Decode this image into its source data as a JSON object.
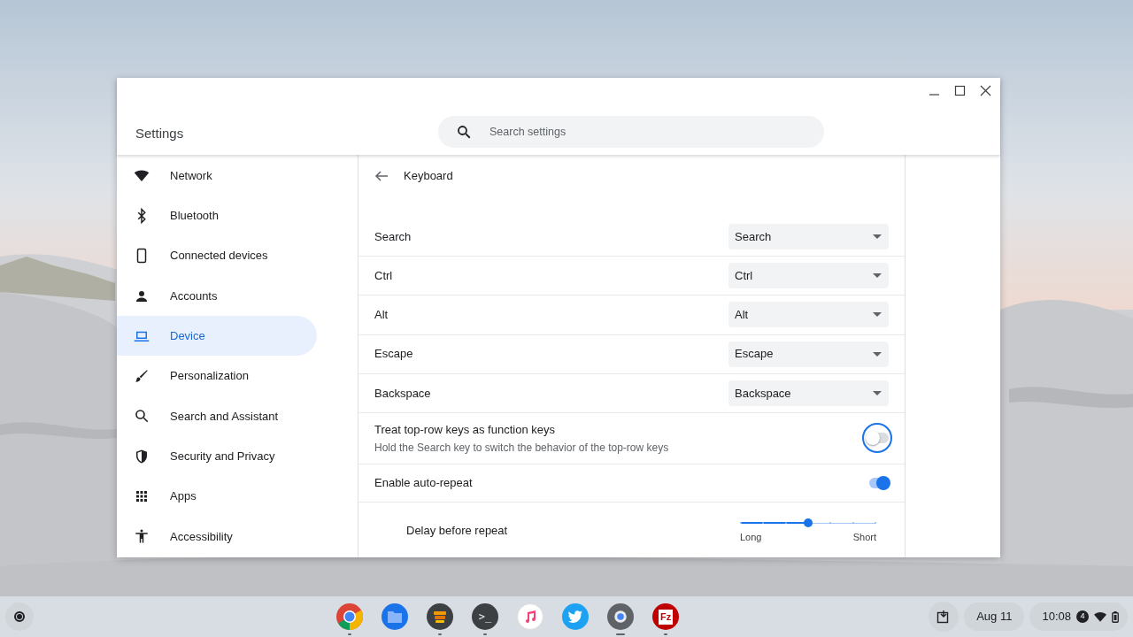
{
  "window": {
    "title": "Settings"
  },
  "search": {
    "placeholder": "Search settings"
  },
  "sidebar": {
    "items": [
      {
        "label": "Network",
        "kind": "wifi",
        "selected": false
      },
      {
        "label": "Bluetooth",
        "kind": "bluetooth",
        "selected": false
      },
      {
        "label": "Connected devices",
        "kind": "phone",
        "selected": false
      },
      {
        "label": "Accounts",
        "kind": "person",
        "selected": false
      },
      {
        "label": "Device",
        "kind": "laptop",
        "selected": true
      },
      {
        "label": "Personalization",
        "kind": "brush",
        "selected": false
      },
      {
        "label": "Search and Assistant",
        "kind": "search",
        "selected": false
      },
      {
        "label": "Security and Privacy",
        "kind": "shield",
        "selected": false
      },
      {
        "label": "Apps",
        "kind": "grid",
        "selected": false
      },
      {
        "label": "Accessibility",
        "kind": "accessibility",
        "selected": false
      }
    ]
  },
  "page": {
    "title": "Keyboard",
    "rows": [
      {
        "kind": "select",
        "label": "Search",
        "value": "Search"
      },
      {
        "kind": "select",
        "label": "Ctrl",
        "value": "Ctrl"
      },
      {
        "kind": "select",
        "label": "Alt",
        "value": "Alt"
      },
      {
        "kind": "select",
        "label": "Escape",
        "value": "Escape"
      },
      {
        "kind": "select",
        "label": "Backspace",
        "value": "Backspace"
      },
      {
        "kind": "toggle",
        "label": "Treat top-row keys as function keys",
        "description": "Hold the Search key to switch the behavior of the top-row keys",
        "on": false,
        "focused": true
      },
      {
        "kind": "toggle",
        "label": "Enable auto-repeat",
        "on": true,
        "focused": false
      },
      {
        "kind": "slider",
        "label": "Delay before repeat",
        "level": 0.5,
        "min_label": "Long",
        "max_label": "Short"
      }
    ]
  },
  "shelf": {
    "apps": [
      {
        "kind": "chrome",
        "running": true,
        "focused": false
      },
      {
        "kind": "files",
        "running": false,
        "focused": false
      },
      {
        "kind": "stack",
        "running": true,
        "focused": false
      },
      {
        "kind": "terminal",
        "label": ">_",
        "running": true,
        "focused": false
      },
      {
        "kind": "music",
        "running": false,
        "focused": false
      },
      {
        "kind": "bird",
        "running": false,
        "focused": false
      },
      {
        "kind": "settings",
        "running": true,
        "focused": true
      },
      {
        "kind": "filezilla",
        "label": "Fz",
        "running": true,
        "focused": false
      }
    ],
    "date": "Aug 11",
    "time": "10:08",
    "notifications": "4"
  }
}
